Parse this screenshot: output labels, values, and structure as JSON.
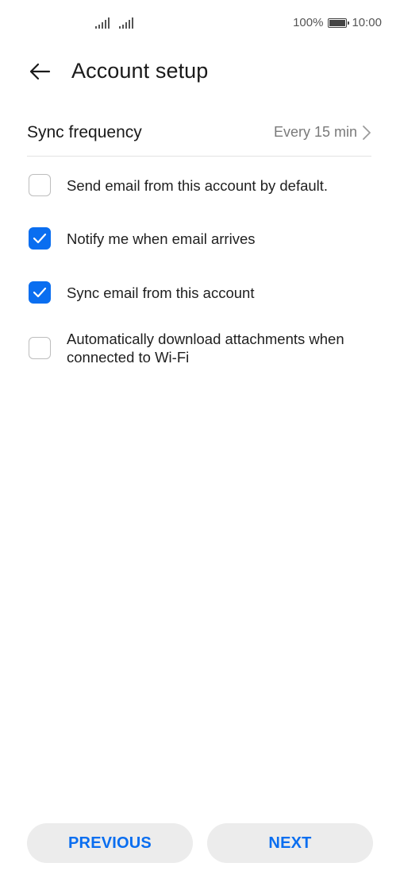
{
  "status_bar": {
    "battery_percent": "100%",
    "time": "10:00",
    "battery_level": 1.0
  },
  "header": {
    "title": "Account setup",
    "back_icon": "arrow-left-icon"
  },
  "sync_frequency": {
    "label": "Sync frequency",
    "value": "Every 15 min",
    "icon": "chevron-right-icon"
  },
  "options": [
    {
      "label": "Send email from this account by default.",
      "checked": false
    },
    {
      "label": "Notify me when email arrives",
      "checked": true
    },
    {
      "label": "Sync email from this account",
      "checked": true
    },
    {
      "label": "Automatically download attachments when connected to Wi-Fi",
      "checked": false
    }
  ],
  "buttons": {
    "previous": "PREVIOUS",
    "next": "NEXT"
  },
  "colors": {
    "accent": "#0a6ef0",
    "button_bg": "#ececec"
  }
}
